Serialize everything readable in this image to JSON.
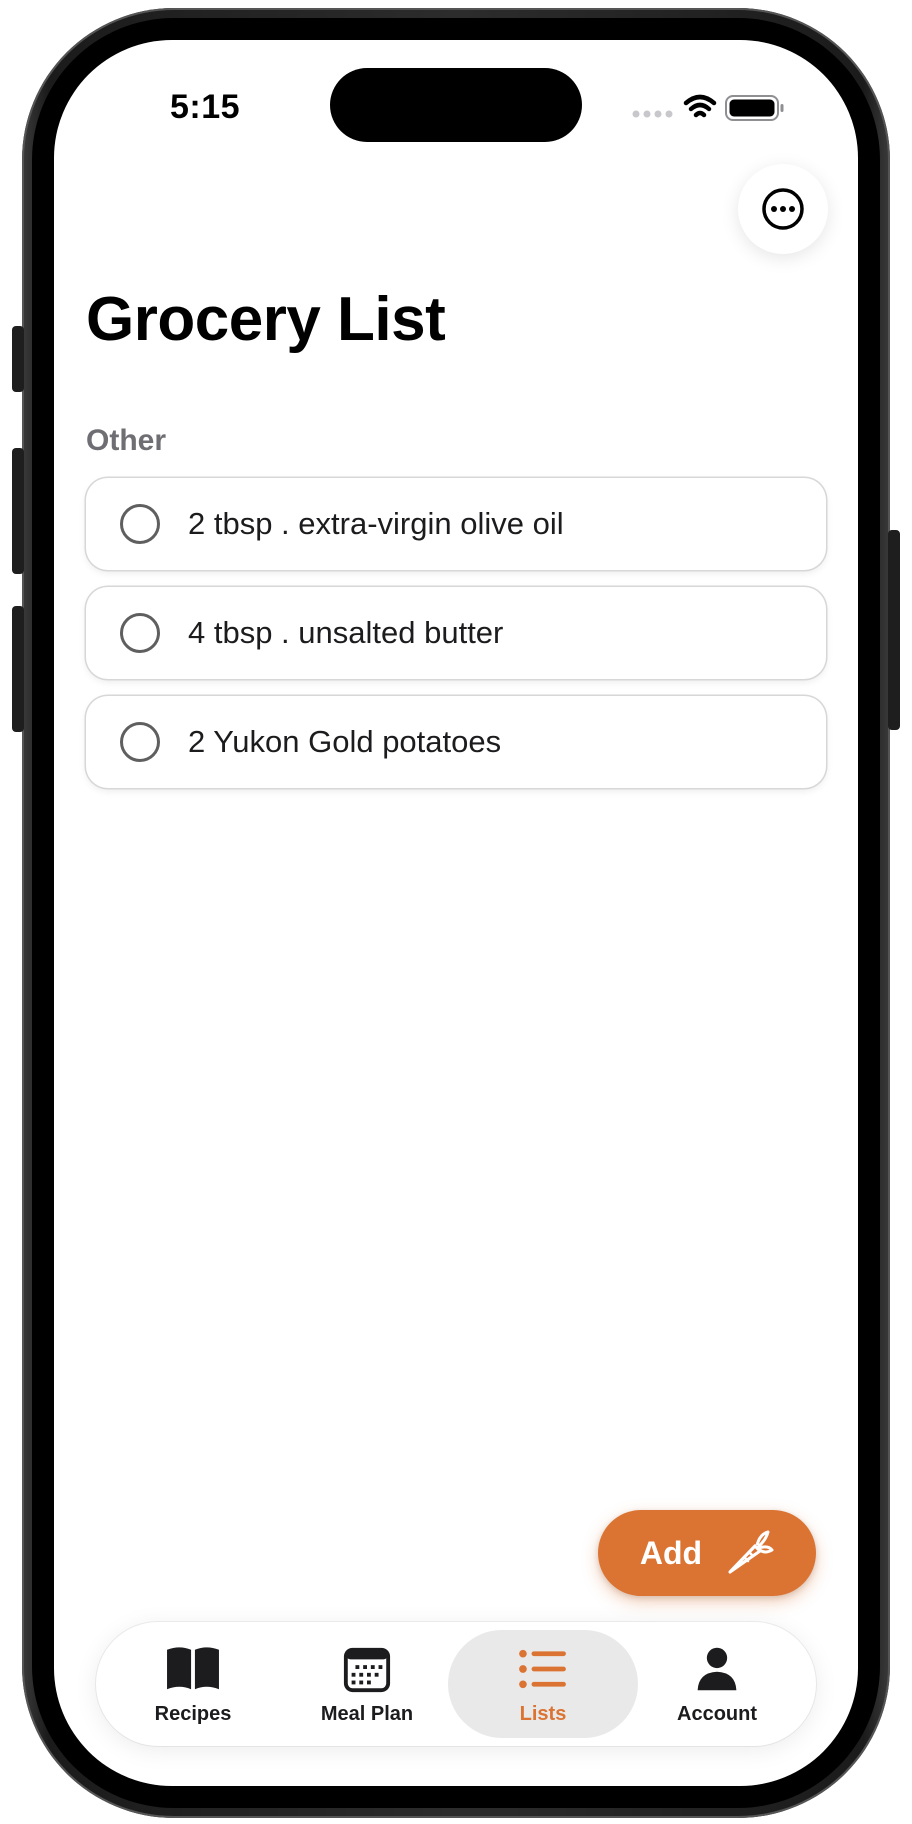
{
  "status_bar": {
    "time": "5:15"
  },
  "header": {
    "title": "Grocery List",
    "menu_icon": "ellipsis-circle-icon"
  },
  "sections": [
    {
      "title": "Other",
      "items": [
        {
          "label": "2 tbsp . extra-virgin olive oil",
          "checked": false
        },
        {
          "label": "4 tbsp . unsalted butter",
          "checked": false
        },
        {
          "label": "2 Yukon Gold potatoes",
          "checked": false
        }
      ]
    }
  ],
  "add_button": {
    "label": "Add",
    "icon": "carrot-icon"
  },
  "tab_bar": {
    "tabs": [
      {
        "label": "Recipes",
        "icon": "book-icon",
        "active": false
      },
      {
        "label": "Meal Plan",
        "icon": "calendar-icon",
        "active": false
      },
      {
        "label": "Lists",
        "icon": "list-icon",
        "active": true
      },
      {
        "label": "Account",
        "icon": "person-icon",
        "active": false
      }
    ]
  },
  "colors": {
    "accent": "#db7433",
    "section_header": "#6e6e73",
    "active_tab_background": "#e9e9e9"
  }
}
